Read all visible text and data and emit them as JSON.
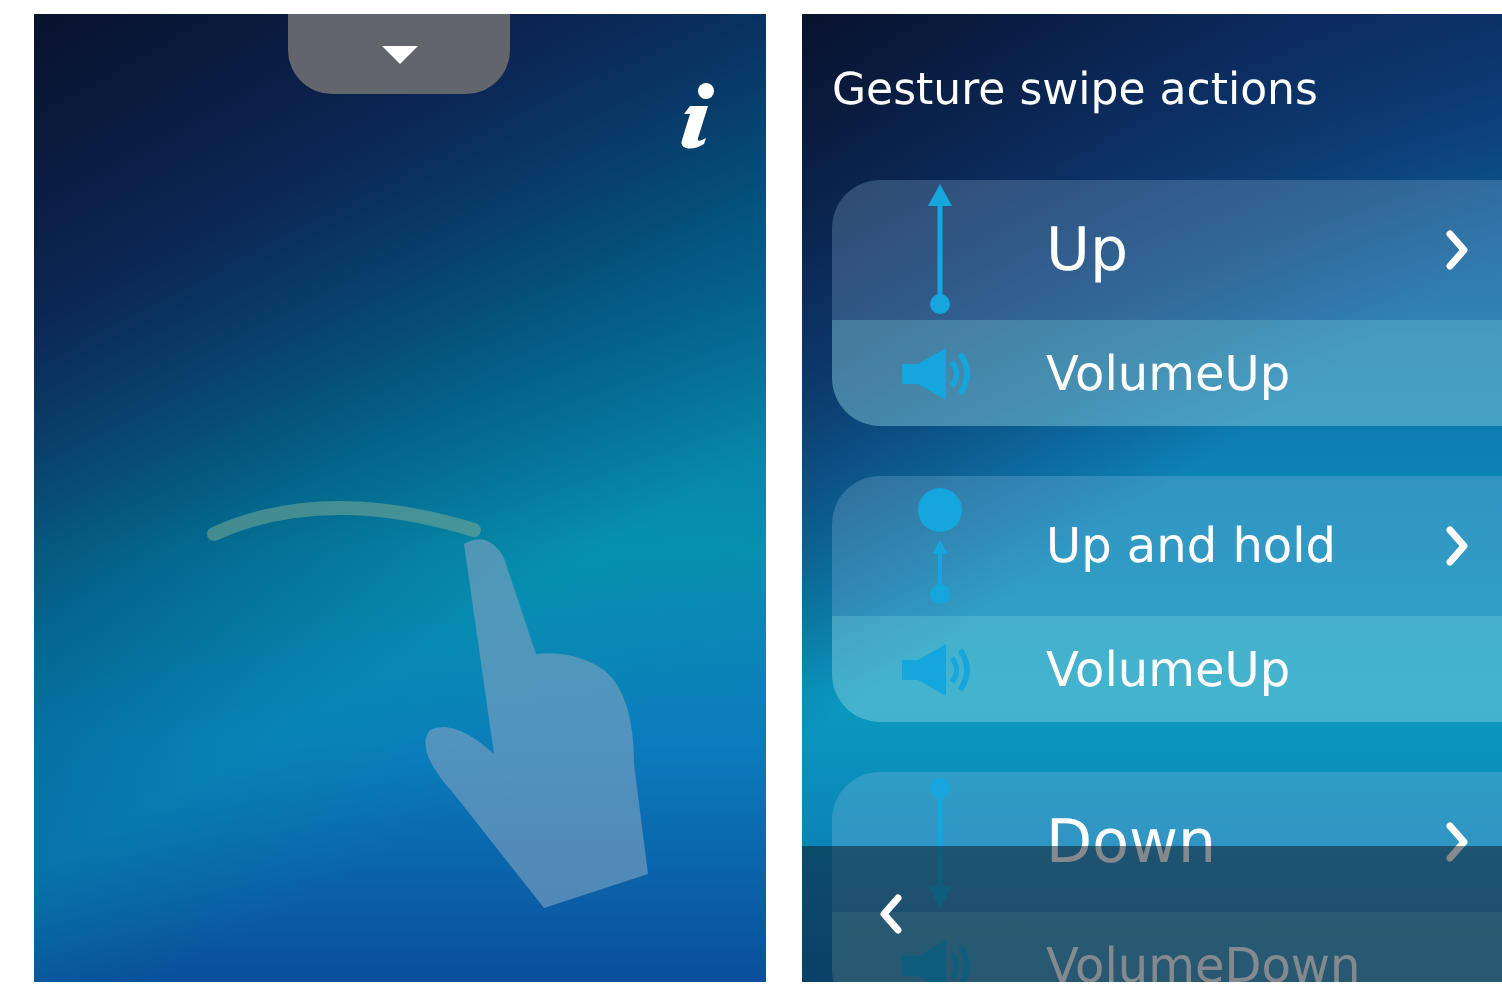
{
  "actions_screen": {
    "title": "Gesture swipe actions",
    "gestures": [
      {
        "kind": "up",
        "label": "Up",
        "action": "VolumeUp"
      },
      {
        "kind": "hold",
        "label": "Up and hold",
        "action": "VolumeUp"
      },
      {
        "kind": "down",
        "label": "Down",
        "action": "VolumeDown"
      }
    ]
  }
}
